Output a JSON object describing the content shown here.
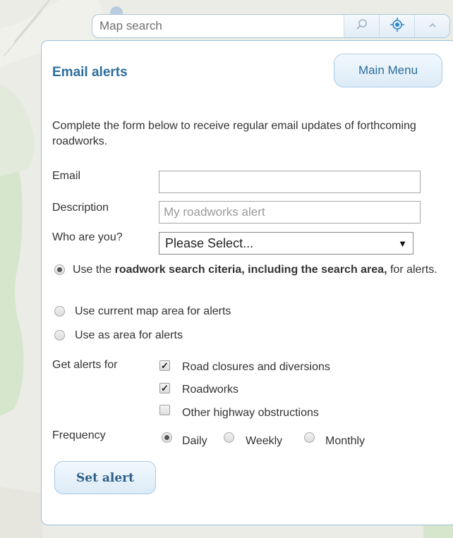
{
  "search": {
    "placeholder": "Map search"
  },
  "toolbar": {
    "search_icon": "search-icon",
    "locate_icon": "locate-icon",
    "collapse_icon": "chevron-up-icon"
  },
  "panel": {
    "title": "Email alerts",
    "main_menu_label": "Main Menu",
    "intro": "Complete the form below to receive regular email updates of forthcoming roadworks."
  },
  "form": {
    "email_label": "Email",
    "email_value": "",
    "description_label": "Description",
    "description_placeholder": "My roadworks alert",
    "who_label": "Who are you?",
    "who_value": "Please Select...",
    "area_options": {
      "search_prefix": "Use the ",
      "search_bold": "roadwork search citeria, including the search area,",
      "search_suffix": " for alerts.",
      "current_map": "Use current map area for alerts",
      "as_area": "Use as area for alerts",
      "selected": "search"
    },
    "alerts_label": "Get alerts for",
    "alerts": [
      {
        "label": "Road closures and diversions",
        "checked": true
      },
      {
        "label": "Roadworks",
        "checked": true
      },
      {
        "label": "Other highway obstructions",
        "checked": false
      }
    ],
    "frequency_label": "Frequency",
    "frequency": [
      {
        "label": "Daily",
        "selected": true
      },
      {
        "label": "Weekly",
        "selected": false
      },
      {
        "label": "Monthly",
        "selected": false
      }
    ],
    "submit_label": "Set alert"
  },
  "colors": {
    "accent": "#2d6d9c",
    "map_bg": "#ecece6",
    "map_green": "#d5e6cd"
  }
}
